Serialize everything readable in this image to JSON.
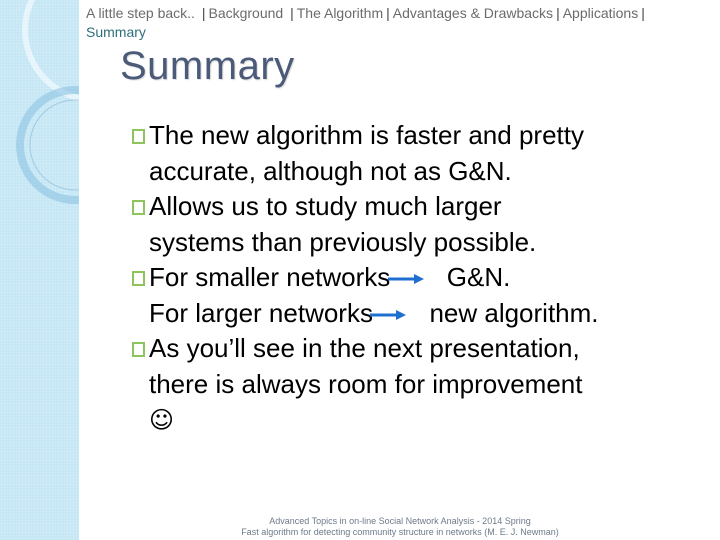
{
  "breadcrumb": {
    "items": [
      "A little step back..",
      "Background",
      "The Algorithm",
      "Advantages & Drawbacks",
      "Applications"
    ],
    "current": "Summary"
  },
  "slide": {
    "title": "Summary",
    "bullets": [
      {
        "lines": [
          "The new algorithm is faster and pretty",
          "accurate, although not as G&N."
        ]
      },
      {
        "lines": [
          "Allows us to study much larger",
          "systems than previously possible."
        ]
      },
      {
        "parts": [
          {
            "left": "For smaller networks",
            "right": "G&N."
          },
          {
            "left": "For larger networks",
            "right": "new algorithm."
          }
        ]
      },
      {
        "lines": [
          "As you’ll see in the next presentation,",
          "there is always room for improvement"
        ],
        "emoji": "☺"
      }
    ]
  },
  "footer": {
    "line1": "Advanced Topics in on-line Social Network Analysis - 2014 Spring",
    "line2": "Fast algorithm for detecting community structure in networks (M. E. J. Newman)"
  },
  "colors": {
    "sidebar": "#c5e6f5",
    "title": "#4a5a78",
    "bullet": "#8ec45c",
    "arrow": "#1f6fd0",
    "breadcrumb_current": "#2e6e7a"
  },
  "icons": {
    "bullet": "square-bullet-icon",
    "arrow": "right-arrow-icon",
    "smiley": "smiley-face-icon"
  }
}
